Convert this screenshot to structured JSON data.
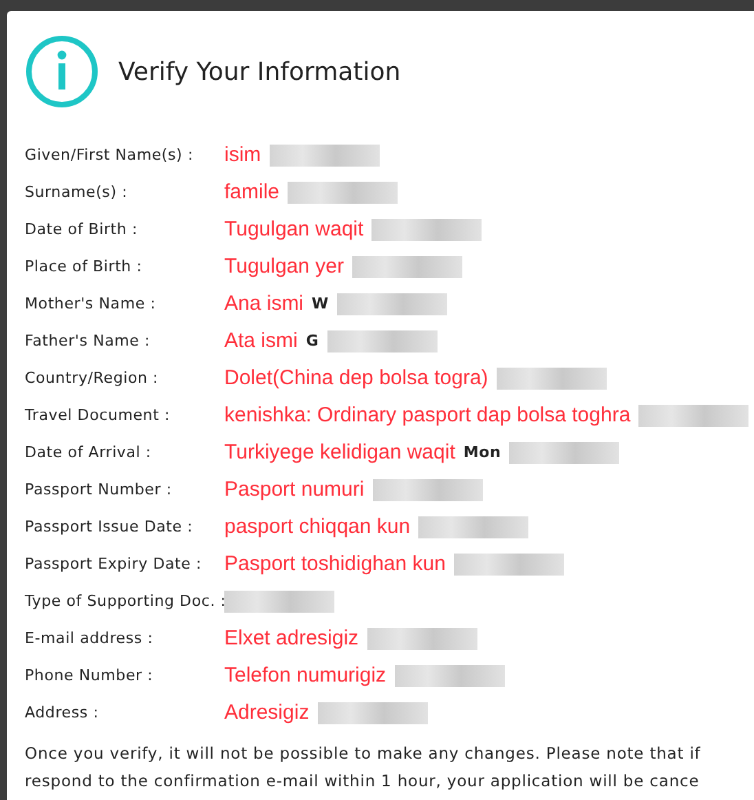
{
  "dialog": {
    "title": "Verify Your Information",
    "fields": [
      {
        "label": "Given/First Name(s) :",
        "note": "isim",
        "redacted": true
      },
      {
        "label": "Surname(s) :",
        "note": "famile",
        "redacted": true
      },
      {
        "label": "Date of Birth :",
        "note": "Tugulgan waqit",
        "redacted": true
      },
      {
        "label": "Place of Birth :",
        "note": "Tugulgan yer",
        "redacted": true
      },
      {
        "label": "Mother's Name :",
        "note": "Ana ismi",
        "value": "W",
        "redacted": true
      },
      {
        "label": "Father's Name :",
        "note": "Ata ismi",
        "value": "G",
        "redacted": true
      },
      {
        "label": "Country/Region :",
        "note": "Dolet(China dep bolsa togra)",
        "redacted": true
      },
      {
        "label": "Travel Document :",
        "note": "kenishka: Ordinary pasport dap bolsa toghra",
        "redacted": true
      },
      {
        "label": "Date of Arrival :",
        "note": "Turkiyege kelidigan waqit",
        "value": "Mon",
        "redacted": true
      },
      {
        "label": "Passport Number :",
        "note": "Pasport numuri",
        "redacted": true
      },
      {
        "label": "Passport Issue Date :",
        "note": "pasport chiqqan kun",
        "redacted": true
      },
      {
        "label": "Passport Expiry Date :",
        "note": "Pasport toshidighan kun",
        "redacted": true
      },
      {
        "label": "Type of Supporting Doc. :",
        "redacted": true
      },
      {
        "label": "E-mail address :",
        "note": "Elxet adresigiz",
        "redacted": true
      },
      {
        "label": "Phone Number :",
        "note": "Telefon numurigiz",
        "redacted": true
      },
      {
        "label": "Address :",
        "note": "Adresigiz",
        "redacted": true
      }
    ],
    "notice": [
      "Once you verify, it will not be possible to make any changes. Please note that if",
      "respond to the confirmation e-mail within 1 hour, your application will be cance"
    ]
  }
}
